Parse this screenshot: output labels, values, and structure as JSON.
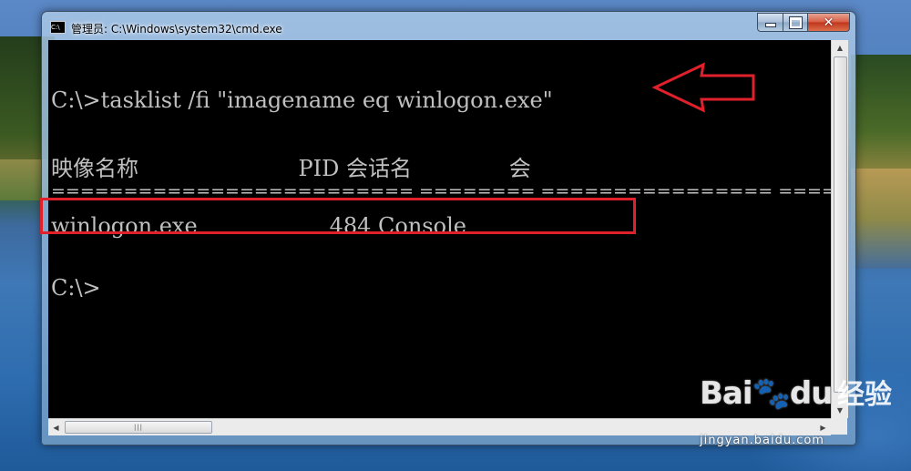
{
  "window": {
    "icon_label": "C:\\",
    "title": "管理员: C:\\Windows\\system32\\cmd.exe"
  },
  "console": {
    "command_line": "C:\\>tasklist /fi \"imagename eq winlogon.exe\"",
    "header": "映像名称                       PID 会话名              会",
    "separator": "========================= ======== ================ =====",
    "result_row": "winlogon.exe                   484 Console",
    "prompt": "C:\\>"
  },
  "watermark": {
    "brand": "Bai",
    "brand2": "du",
    "suffix": "经验",
    "url": "jingyan.baidu.com"
  },
  "colors": {
    "console_bg": "#000000",
    "console_text": "#c0c0c0",
    "annotation": "#e0212b"
  },
  "icons": [
    "cmd-window-icon",
    "minimize-icon",
    "maximize-icon",
    "close-icon",
    "red-arrow-icon",
    "scroll-up-icon",
    "scroll-down-icon",
    "scroll-left-icon",
    "scroll-right-icon"
  ]
}
